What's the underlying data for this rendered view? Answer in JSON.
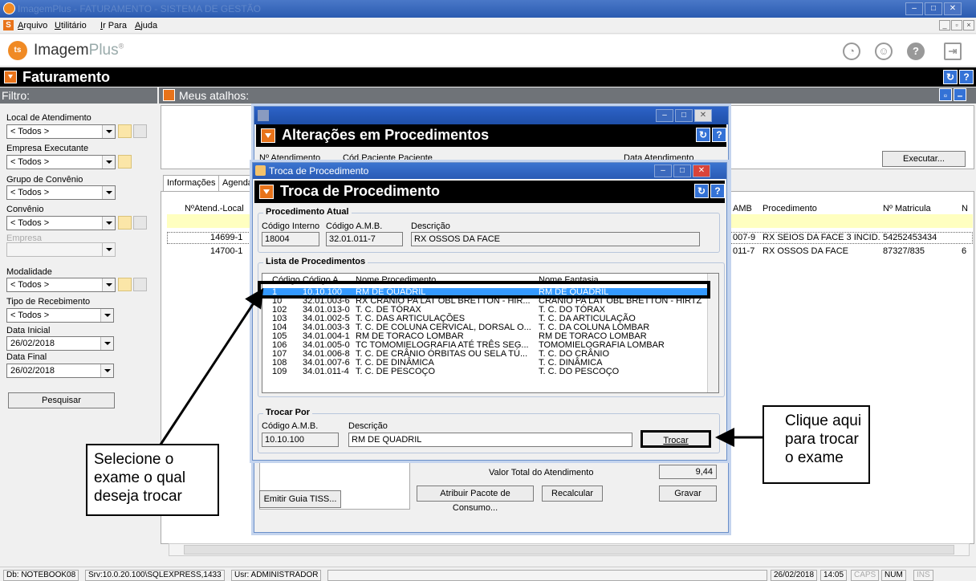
{
  "window": {
    "title": "ImagemPlus - FATURAMENTO - SISTEMA DE GESTÃO",
    "controls": [
      "–",
      "□",
      "✕"
    ]
  },
  "menu": {
    "items": [
      "Arquivo",
      "Utilitário",
      "Ir Para",
      "Ajuda"
    ],
    "mdi_controls": [
      "_",
      "▫",
      "×"
    ]
  },
  "brand": {
    "name": "Imagem",
    "suffix": "Plus",
    "mark": "®"
  },
  "faturamento": {
    "title": "Faturamento"
  },
  "filtro": {
    "header": "Filtro:",
    "fields": [
      {
        "label": "Local de Atendimento",
        "value": "< Todos >"
      },
      {
        "label": "Empresa Executante",
        "value": "< Todos >"
      },
      {
        "label": "Grupo de Convênio",
        "value": "< Todos >"
      },
      {
        "label": "Convênio",
        "value": "< Todos >"
      },
      {
        "label": "Empresa",
        "value": ""
      },
      {
        "label": "Modalidade",
        "value": "< Todos >"
      },
      {
        "label": "Tipo de Recebimento",
        "value": "< Todos >"
      },
      {
        "label": "Data Inicial",
        "value": "26/02/2018"
      },
      {
        "label": "Data Final",
        "value": "26/02/2018"
      }
    ],
    "search_button": "Pesquisar"
  },
  "atalhos": {
    "header": "Meus atalhos:",
    "execute_button": "Executar..."
  },
  "tabs": [
    "Informações",
    "Agendar"
  ],
  "grid": {
    "headers_left": [
      "NºAtend.-Local"
    ],
    "headers_right": [
      "AMB",
      "Procedimento",
      "Nº Matricula",
      "N"
    ],
    "rows": [
      {
        "num": "14699-1",
        "amb": "007-9",
        "proc": "RX SEIOS DA FACE 3 INCID.",
        "mat": "54252453434",
        "n": ""
      },
      {
        "num": "14700-1",
        "amb": "011-7",
        "proc": "RX OSSOS DA FACE",
        "mat": "87327/835",
        "n": "6"
      }
    ]
  },
  "alteracoes": {
    "title": "Alterações em Procedimentos",
    "cols": [
      "Nº Atendimento",
      "Cód.Paciente  Paciente",
      "Data Atendimento"
    ],
    "valor_label": "Valor Total do Atendimento",
    "valor": "9,44",
    "buttons": {
      "tiss": "Emitir Guia TISS...",
      "pacote": "Atribuir Pacote de Consumo...",
      "recalc": "Recalcular",
      "gravar": "Gravar"
    }
  },
  "troca": {
    "window_title": "Troca de Procedimento",
    "title": "Troca de Procedimento",
    "atual": {
      "legend": "Procedimento Atual",
      "labels": [
        "Código Interno",
        "Código A.M.B.",
        "Descrição"
      ],
      "codigo_interno": "18004",
      "codigo_amb": "32.01.011-7",
      "descricao": "RX OSSOS DA FACE"
    },
    "lista": {
      "legend": "Lista de Procedimentos",
      "headers": [
        "Código",
        "Código A...",
        "Nome Procedimento",
        "Nome Fantasia"
      ],
      "rows": [
        [
          "1",
          "10.10.100",
          "RM DE QUADRIL",
          "RM DE QUADRIL"
        ],
        [
          "10",
          "32.01.003-6",
          "RX CRÂNIO PA LAT OBL BRETTON - HIR...",
          "CRÂNIO PA LAT OBL BRETTON - HIRTZ"
        ],
        [
          "102",
          "34.01.013-0",
          "T. C. DE TÓRAX",
          "T. C. DO TÓRAX"
        ],
        [
          "103",
          "34.01.002-5",
          "T. C. DAS ARTICULAÇÕES",
          "T. C. DA ARTICULAÇÃO"
        ],
        [
          "104",
          "34.01.003-3",
          "T. C. DE COLUNA CERVICAL, DORSAL O...",
          "T. C. DA COLUNA LOMBAR"
        ],
        [
          "105",
          "34.01.004-1",
          "RM DE TORACO LOMBAR",
          "RM DE TORACO LOMBAR"
        ],
        [
          "106",
          "34.01.005-0",
          "TC TOMOMIELOGRAFIA ATÉ TRÊS SEG...",
          "TOMOMIELOGRAFIA LOMBAR"
        ],
        [
          "107",
          "34.01.006-8",
          "T. C. DE CRÂNIO ÓRBITAS OU SELA TÚ...",
          "T. C. DO CRÂNIO"
        ],
        [
          "108",
          "34.01.007-6",
          "T. C. DE DINÂMICA",
          "T. C. DINÂMICA"
        ],
        [
          "109",
          "34.01.011-4",
          "T. C. DE PESCOÇO",
          "T. C. DO PESCOÇO"
        ]
      ]
    },
    "trocar_por": {
      "legend": "Trocar Por",
      "labels": [
        "Código A.M.B.",
        "Descrição"
      ],
      "codigo_amb": "10.10.100",
      "descricao": "RM DE QUADRIL",
      "button": "Trocar"
    }
  },
  "callouts": {
    "left": [
      "Selecione o",
      "exame o qual",
      "deseja trocar"
    ],
    "right": [
      "Clique aqui",
      "para  trocar",
      "o exame"
    ]
  },
  "statusbar": {
    "db": "Db: NOTEBOOK08",
    "srv": "Srv:10.0.20.100\\SQLEXPRESS,1433",
    "usr": "Usr: ADMINISTRADOR",
    "date": "26/02/2018",
    "time": "14:05",
    "caps": "CAPS",
    "num": "NUM",
    "ins": "INS"
  },
  "colors": {
    "accent_orange": "#e8731a",
    "selection_blue": "#3399ff",
    "header_gray": "#6f7378"
  }
}
